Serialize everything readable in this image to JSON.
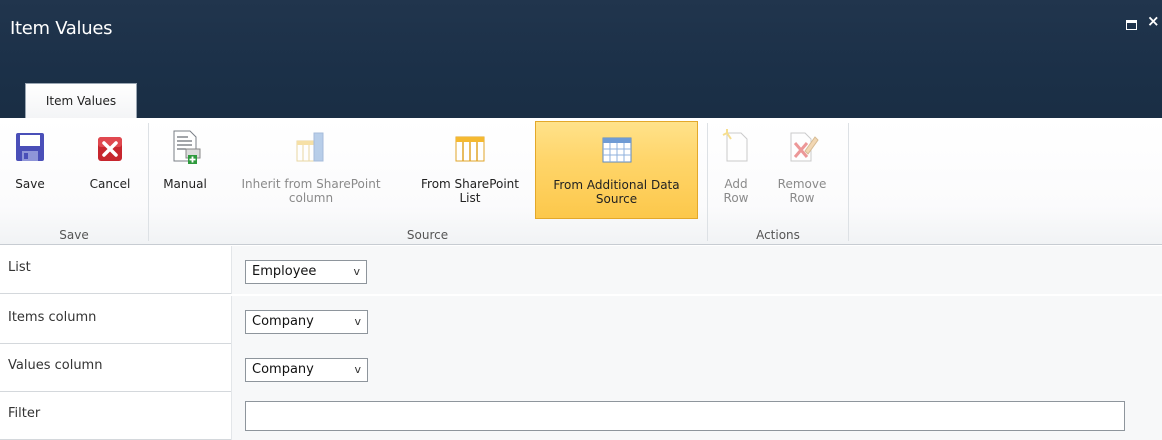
{
  "window": {
    "title": "Item Values",
    "tab_label": "Item Values",
    "close_glyph": "×"
  },
  "ribbon": {
    "groups": {
      "save": {
        "label": "Save",
        "buttons": [
          {
            "label": "Save",
            "icon": "floppy-disk-icon"
          },
          {
            "label": "Cancel",
            "icon": "red-x-cancel-icon"
          }
        ]
      },
      "source": {
        "label": "Source",
        "buttons": [
          {
            "label": "Manual",
            "icon": "manual-entry-icon",
            "state": "enabled"
          },
          {
            "label_line1": "Inherit from SharePoint",
            "label_line2": "column",
            "icon": "column-icon",
            "state": "disabled"
          },
          {
            "label_line1": "From SharePoint",
            "label_line2": "List",
            "icon": "list-icon",
            "state": "enabled"
          },
          {
            "label_line1": "From Additional Data",
            "label_line2": "Source",
            "icon": "table-icon",
            "state": "selected"
          }
        ]
      },
      "actions": {
        "label": "Actions",
        "buttons": [
          {
            "label_line1": "Add",
            "label_line2": "Row",
            "icon": "add-row-icon",
            "state": "disabled"
          },
          {
            "label_line1": "Remove",
            "label_line2": "Row",
            "icon": "remove-row-icon",
            "state": "disabled"
          }
        ]
      }
    }
  },
  "form": {
    "rows": [
      {
        "label": "List",
        "value": "Employee",
        "type": "select"
      },
      {
        "label": "Items column",
        "value": "Company",
        "type": "select"
      },
      {
        "label": "Values column",
        "value": "Company",
        "type": "select"
      },
      {
        "label": "Filter",
        "value": "",
        "type": "text"
      }
    ],
    "chevron_glyph": "v"
  },
  "colors": {
    "title_bar": "#1f344c",
    "selected_button": "#fdd262",
    "selected_border": "#e3a82a"
  }
}
